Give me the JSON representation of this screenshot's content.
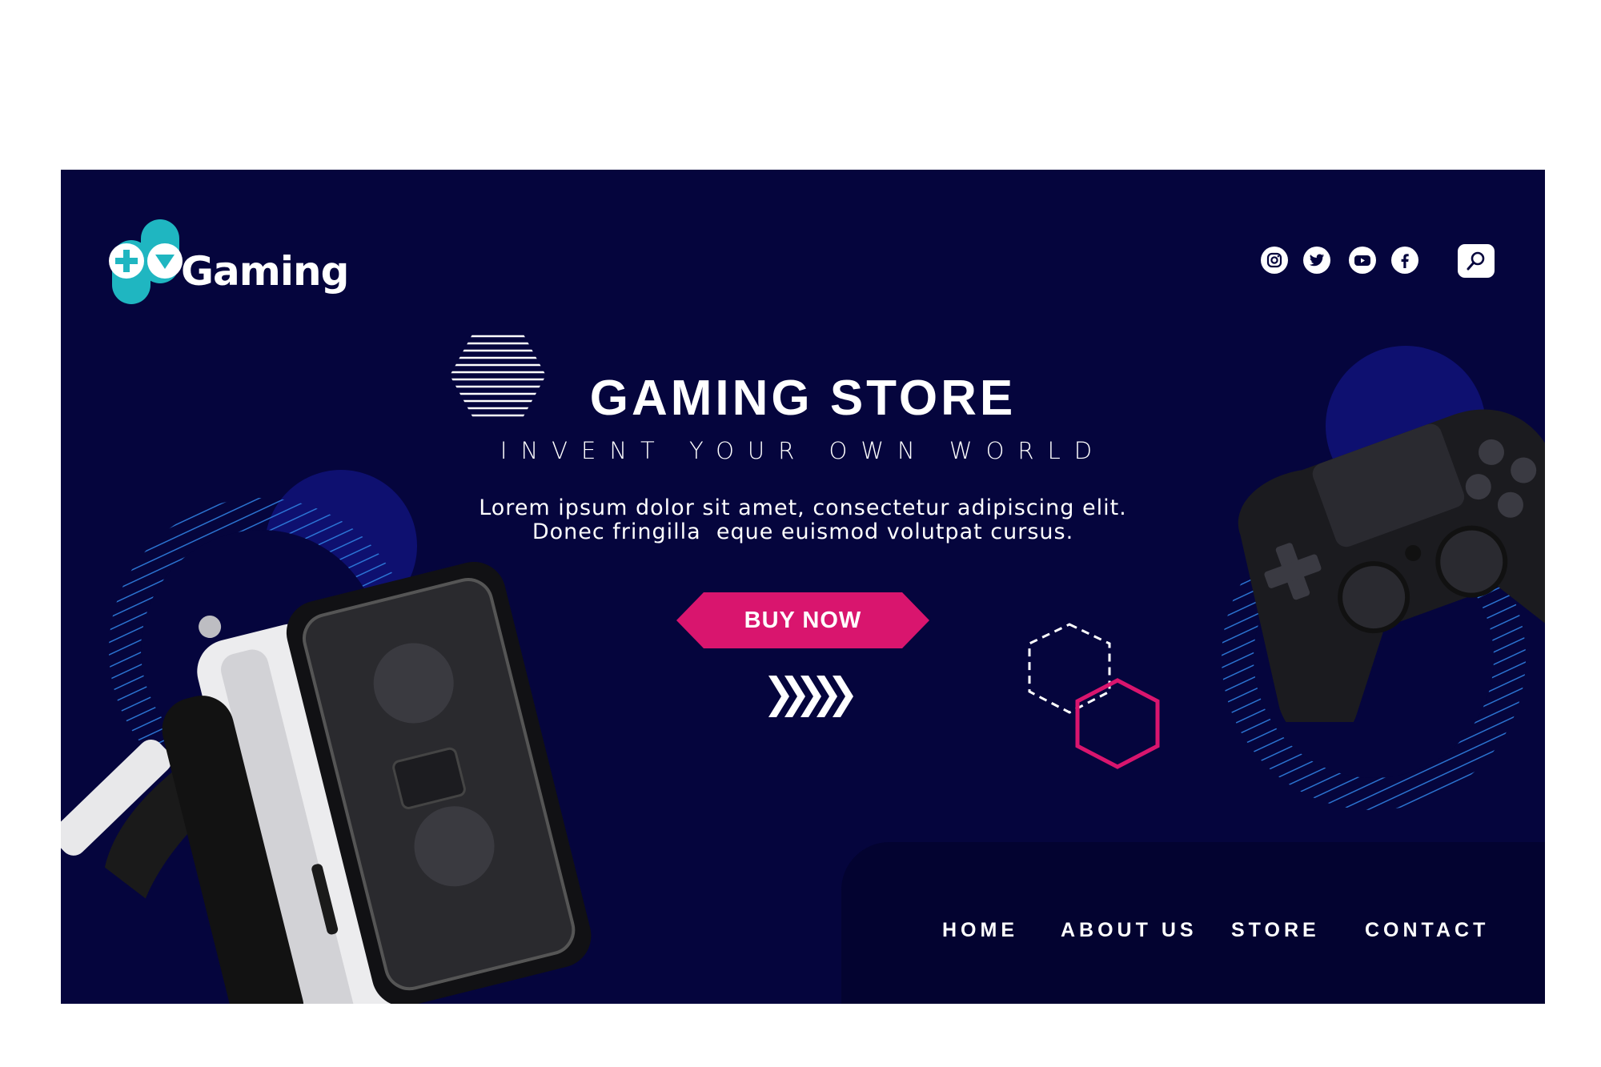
{
  "brand": {
    "name": "Gaming",
    "colors": {
      "background": "#05053d",
      "accent": "#d9156e",
      "teal": "#1fb6c1",
      "nav_panel": "#030330"
    }
  },
  "header": {
    "social": [
      {
        "name": "instagram",
        "icon": "instagram-icon"
      },
      {
        "name": "twitter",
        "icon": "twitter-icon"
      },
      {
        "name": "youtube",
        "icon": "youtube-icon"
      },
      {
        "name": "facebook",
        "icon": "facebook-icon"
      }
    ],
    "search_icon": "search-icon"
  },
  "hero": {
    "title": "GAMING STORE",
    "subtitle": "INVENT YOUR OWN WORLD",
    "body_line1": "Lorem ipsum dolor sit amet, consectetur adipiscing elit.",
    "body_line2": "Donec fringilla  eque euismod volutpat cursus.",
    "cta_label": "BUY NOW"
  },
  "nav": {
    "items": [
      {
        "label": "HOME"
      },
      {
        "label": "ABOUT US"
      },
      {
        "label": "STORE"
      },
      {
        "label": "CONTACT"
      }
    ]
  }
}
